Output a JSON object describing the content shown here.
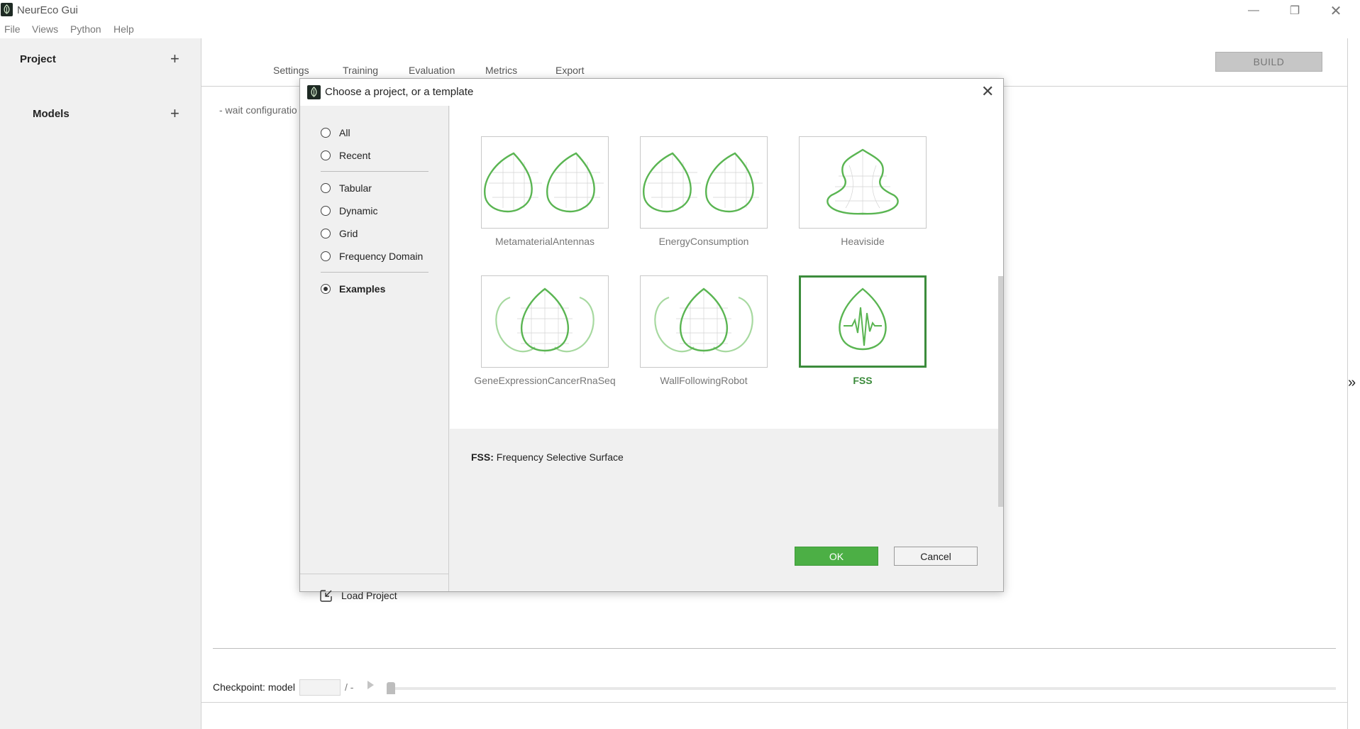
{
  "window": {
    "title": "NeurEco Gui"
  },
  "menu": [
    "File",
    "Views",
    "Python",
    "Help"
  ],
  "sidebar": {
    "project_label": "Project",
    "models_label": "Models"
  },
  "tabs": [
    "Settings",
    "Training",
    "Evaluation",
    "Metrics",
    "Export"
  ],
  "build_label": "BUILD",
  "status_text": "- wait configuratio",
  "checkpoint": {
    "label": "Checkpoint: model",
    "value": "",
    "total": "/ -",
    "slider_position": 0
  },
  "dialog": {
    "title": "Choose a project, or a template",
    "filters": [
      {
        "label": "All",
        "checked": false
      },
      {
        "label": "Recent",
        "checked": false
      },
      {
        "label": "Tabular",
        "checked": false
      },
      {
        "label": "Dynamic",
        "checked": false
      },
      {
        "label": "Grid",
        "checked": false
      },
      {
        "label": "Frequency Domain",
        "checked": false
      },
      {
        "label": "Examples",
        "checked": true
      }
    ],
    "load_project_label": "Load Project",
    "tiles": [
      {
        "label": "MetamaterialAntennas",
        "icon": "double-leaf-icon",
        "selected": false
      },
      {
        "label": "EnergyConsumption",
        "icon": "double-leaf-icon",
        "selected": false
      },
      {
        "label": "Heaviside",
        "icon": "vase-icon",
        "selected": false
      },
      {
        "label": "GeneExpressionCancerRnaSeq",
        "icon": "triple-leaf-icon",
        "selected": false
      },
      {
        "label": "WallFollowingRobot",
        "icon": "triple-leaf-icon",
        "selected": false
      },
      {
        "label": "FSS",
        "icon": "signal-leaf-icon",
        "selected": true
      }
    ],
    "description": {
      "name": "FSS:",
      "text": "Frequency Selective Surface"
    },
    "ok_label": "OK",
    "cancel_label": "Cancel"
  },
  "colors": {
    "accent": "#4caf45",
    "selected_border": "#3c8c3c",
    "icon_green": "#5ab552"
  }
}
